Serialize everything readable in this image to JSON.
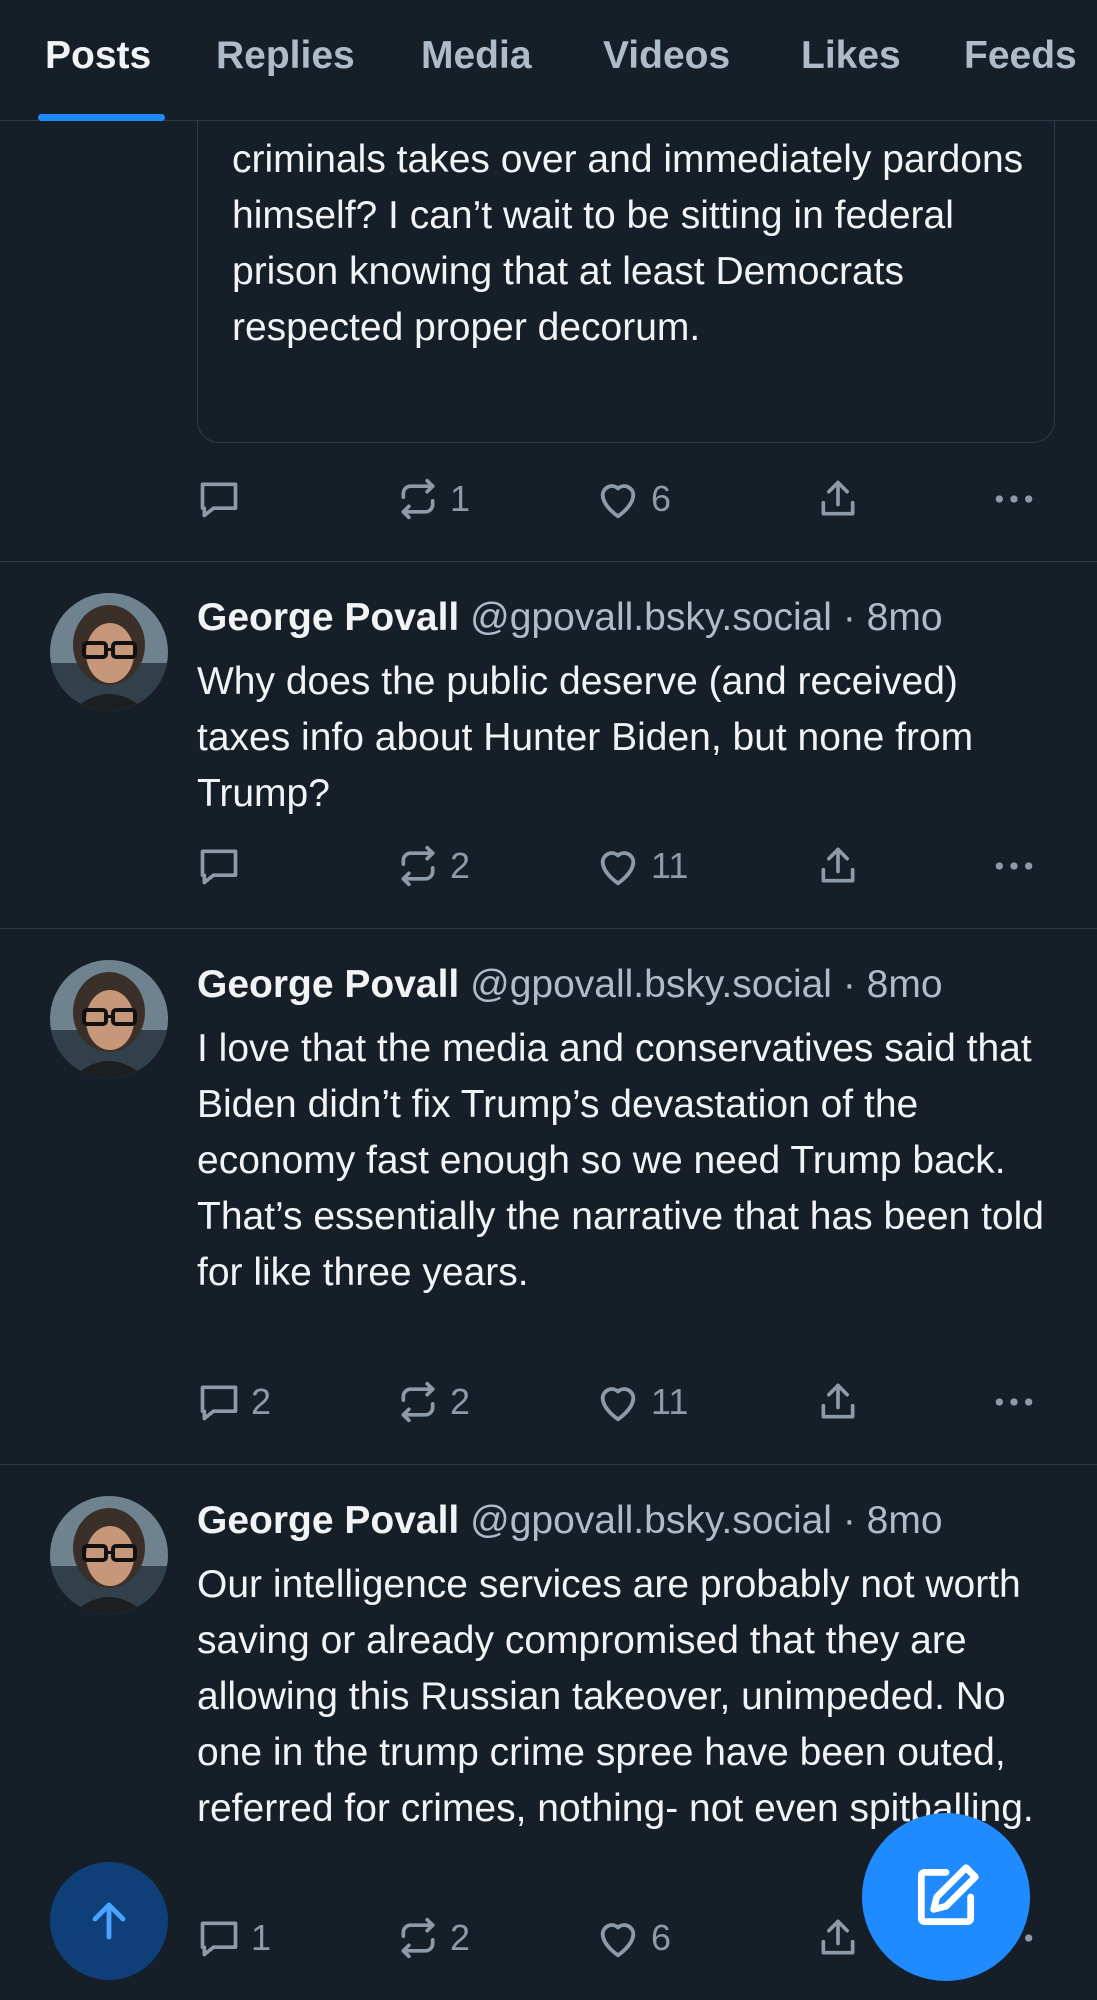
{
  "tabs": [
    "Posts",
    "Replies",
    "Media",
    "Videos",
    "Likes",
    "Feeds"
  ],
  "quoted_post": {
    "text": "criminals takes over and immediately pardons himself? I can’t wait to be sitting in federal prison knowing that at least Democrats respected proper decorum.",
    "replies": "",
    "reposts": "1",
    "likes": "6"
  },
  "posts": [
    {
      "author": "George Povall",
      "handle": "@gpovall.bsky.social",
      "time": "· 8mo",
      "text": "Why does the public deserve (and received) taxes info about Hunter Biden, but none from Trump?",
      "replies": "",
      "reposts": "2",
      "likes": "11"
    },
    {
      "author": "George Povall",
      "handle": "@gpovall.bsky.social",
      "time": "· 8mo",
      "text": "I love that the media and conservatives said that Biden didn’t fix Trump’s devastation of the economy fast enough so we need Trump back. That’s essentially the narrative that has been told for like three years.",
      "replies": "2",
      "reposts": "2",
      "likes": "11"
    },
    {
      "author": "George Povall",
      "handle": "@gpovall.bsky.social",
      "time": "· 8mo",
      "text": "Our intelligence services are probably not worth saving or already compromised that they are allowing this Russian takeover, unimpeded. No one in the trump crime spree have been outed, referred for crimes, nothing- not even spitballing.",
      "replies": "1",
      "reposts": "2",
      "likes": "6"
    }
  ],
  "icons": {
    "reply": "speech-bubble-icon",
    "repost": "repost-arrows-icon",
    "like": "heart-icon",
    "share": "share-upload-icon",
    "more": "ellipsis-icon",
    "scroll_top": "arrow-up-icon",
    "compose": "compose-pencil-icon"
  },
  "colors": {
    "background": "#161e27",
    "accent": "#208bfe",
    "text": "#f1f3f5",
    "muted": "#aebbc9",
    "divider": "#2e3a48"
  }
}
